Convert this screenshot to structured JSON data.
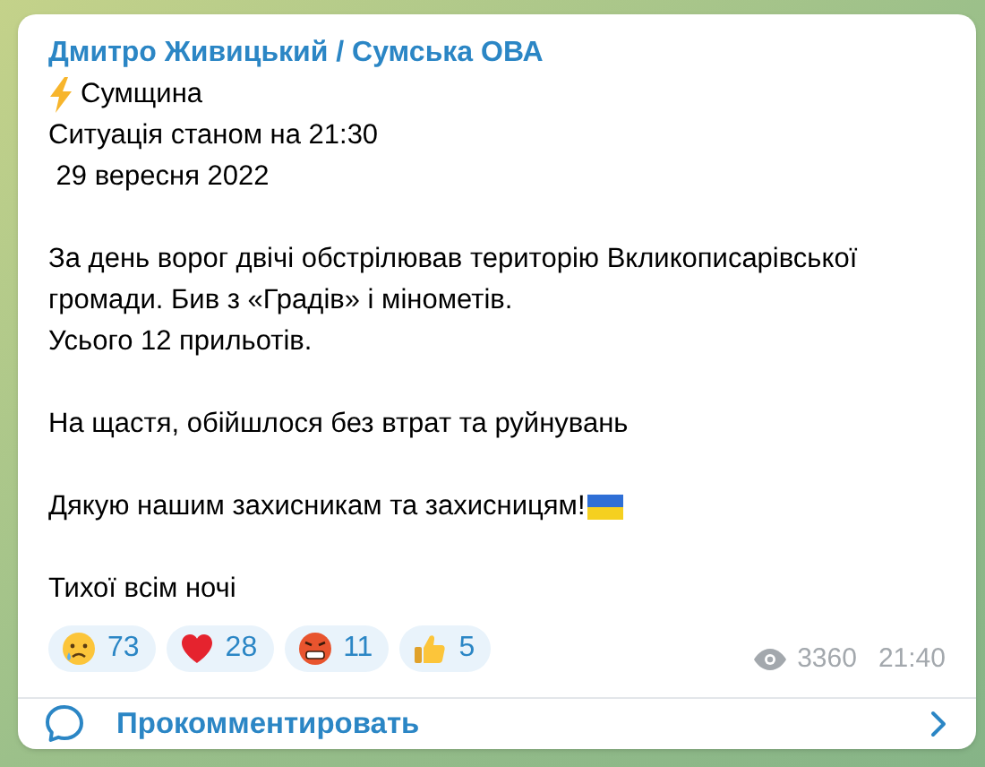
{
  "message": {
    "author": "Дмитро Живицький / Сумська ОВА",
    "paragraphs": [
      {
        "lines": [
          {
            "kind": "lightning",
            "text": "Сумщина"
          },
          {
            "kind": "plain",
            "text": "Ситуація станом на 21:30"
          },
          {
            "kind": "plain",
            "text": " 29 вересня 2022"
          }
        ]
      },
      {
        "lines": [
          {
            "kind": "plain",
            "text": "За день ворог двічі обстрілював територію Вкликописарівської"
          },
          {
            "kind": "plain",
            "text": "громади. Бив з «Градів» і мінометів."
          },
          {
            "kind": "plain",
            "text": "Усього 12 прильотів."
          }
        ]
      },
      {
        "lines": [
          {
            "kind": "plain",
            "text": "На щастя, обійшлося без втрат та руйнувань"
          }
        ]
      },
      {
        "lines": [
          {
            "kind": "flag",
            "text": "Дякую нашим захисникам та захисницям!"
          }
        ]
      },
      {
        "lines": [
          {
            "kind": "plain",
            "text": "Тихої всім ночі"
          }
        ]
      }
    ],
    "reactions": [
      {
        "kind": "crying",
        "count": "73"
      },
      {
        "kind": "heart",
        "count": "28"
      },
      {
        "kind": "angry",
        "count": "11"
      },
      {
        "kind": "thumbs_up",
        "count": "5"
      }
    ],
    "views": "3360",
    "time": "21:40"
  },
  "comment_button": {
    "label": "Прокомментировать"
  }
}
